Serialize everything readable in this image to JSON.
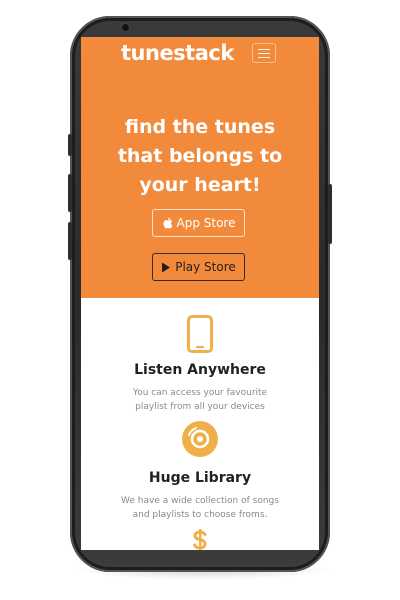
{
  "header": {
    "brand": "tunestack",
    "menu_icon": "hamburger-menu-icon"
  },
  "hero": {
    "headline_lines": [
      "find the tunes",
      "that belongs to",
      "your heart!"
    ],
    "buttons": [
      {
        "label": "App Store",
        "icon": "apple-icon"
      },
      {
        "label": "Play Store",
        "icon": "play-store-icon"
      }
    ]
  },
  "features": [
    {
      "icon": "mobile-phone-icon",
      "title": "Listen Anywhere",
      "desc_lines": [
        "You can access your favourite",
        "playlist from all your devices"
      ]
    },
    {
      "icon": "music-disc-icon",
      "title": "Huge Library",
      "desc_lines": [
        "We have a wide collection of songs",
        "and playlists to choose froms."
      ]
    },
    {
      "icon": "dollar-icon"
    }
  ],
  "colors": {
    "accent": "#f28a3c",
    "icon": "#f0b049",
    "title": "#222222",
    "muted": "#8a8a8a"
  }
}
